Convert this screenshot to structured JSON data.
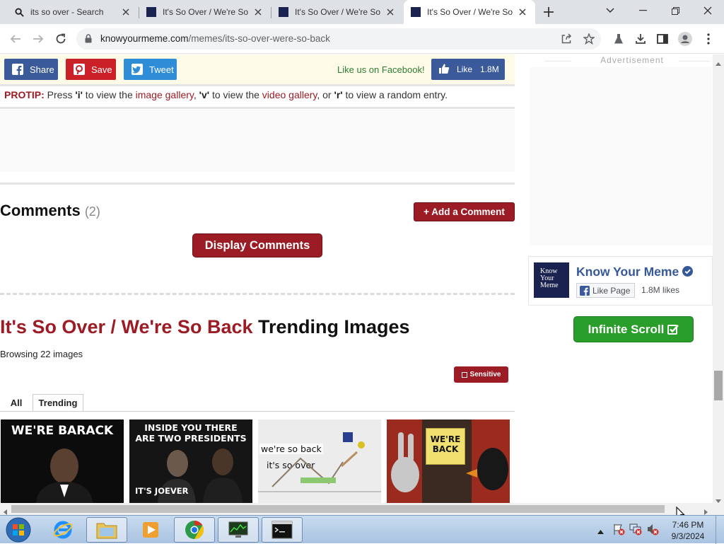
{
  "browser": {
    "tabs": [
      {
        "title": "its so over - Search",
        "active": false
      },
      {
        "title": "It's So Over / We're So",
        "active": false
      },
      {
        "title": "It's So Over / We're So",
        "active": false
      },
      {
        "title": "It's So Over / We're So",
        "active": true
      }
    ],
    "url_domain": "knowyourmeme.com",
    "url_path": "/memes/its-so-over-were-so-back"
  },
  "share_bar": {
    "share_label": "Share",
    "save_label": "Save",
    "tweet_label": "Tweet",
    "like_us_text": "Like us on Facebook!",
    "like_label": "Like",
    "like_count": "1.8M",
    "colors": {
      "facebook": "#3b5a9a",
      "pinterest": "#cb2027",
      "twitter": "#2e8dd6"
    }
  },
  "protip": {
    "label": "PROTIP:",
    "t1": " Press ",
    "k1": "'i'",
    "t2": " to view the ",
    "link1": "image gallery",
    "t3": ", ",
    "k2": "'v'",
    "t4": " to view the ",
    "link2": "video gallery",
    "t5": ", or ",
    "k3": "'r'",
    "t6": " to view a random entry."
  },
  "comments": {
    "title": "Comments",
    "count": "(2)",
    "add_label": "+ Add a Comment",
    "display_label": "Display Comments"
  },
  "gallery": {
    "title_red": "It's So Over / We're So Back",
    "title_black": " Trending Images",
    "browsing": "Browsing 22 images",
    "sensitive_label": "Sensitive",
    "tabs": [
      "All",
      "Trending"
    ],
    "active_tab": "Trending",
    "thumbnails": [
      {
        "caption": "WE'RE BARACK"
      },
      {
        "caption_top": "INSIDE YOU THERE ARE TWO PRESIDENTS",
        "caption_bottom": "IT'S JOEVER"
      },
      {
        "caption_top": "we're so back",
        "caption_bottom": "it's so over"
      },
      {
        "sign": "WE'RE BACK"
      }
    ]
  },
  "sidebar": {
    "ad_label": "Advertisement",
    "kym_logo_text": [
      "Know",
      "Your",
      "Meme"
    ],
    "kym_name": "Know Your Meme",
    "like_page_label": "Like Page",
    "likes": "1.8M likes",
    "infinite_scroll_label": "Infinite Scroll"
  },
  "taskbar": {
    "time": "7:46 PM",
    "date": "9/3/2024"
  },
  "accent_color": "#9b1c24"
}
